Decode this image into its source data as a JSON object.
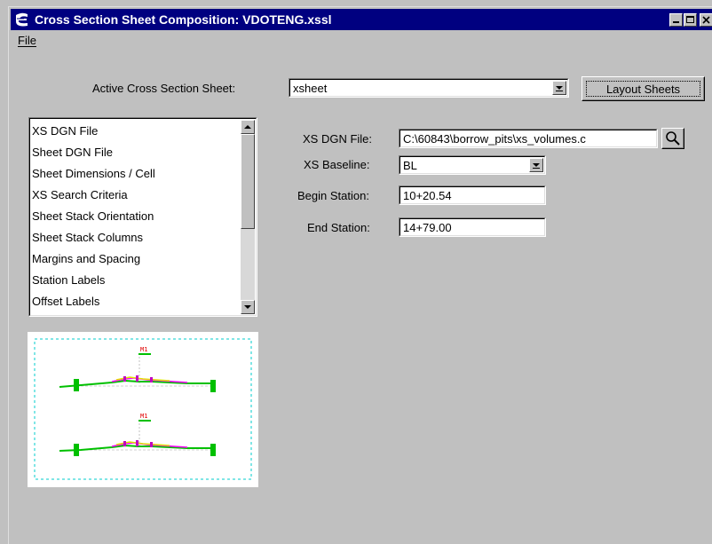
{
  "window": {
    "title": "Cross Section Sheet Composition: VDOTENG.xssl"
  },
  "menu": {
    "file": "File"
  },
  "active_sheet": {
    "label": "Active Cross Section Sheet:",
    "value": "xsheet"
  },
  "layout_button": "Layout Sheets",
  "list": {
    "items": [
      "XS DGN File",
      "Sheet DGN File",
      "Sheet Dimensions / Cell",
      "XS Search Criteria",
      "Sheet Stack Orientation",
      "Sheet Stack Columns",
      "Margins and Spacing",
      "Station Labels",
      "Offset Labels"
    ]
  },
  "form": {
    "xs_dgn_file": {
      "label": "XS DGN File:",
      "value": "C:\\60843\\borrow_pits\\xs_volumes.c"
    },
    "xs_baseline": {
      "label": "XS Baseline:",
      "value": "BL"
    },
    "begin_station": {
      "label": "Begin Station:",
      "value": "10+20.54"
    },
    "end_station": {
      "label": "End Station:",
      "value": "14+79.00"
    }
  },
  "preview": {
    "sheet_label_1": "M1",
    "sheet_label_2": "M1"
  },
  "colors": {
    "titlebar": "#000080",
    "face": "#c0c0c0",
    "preview_border": "#00cccc",
    "ground_line": "#00b000"
  }
}
